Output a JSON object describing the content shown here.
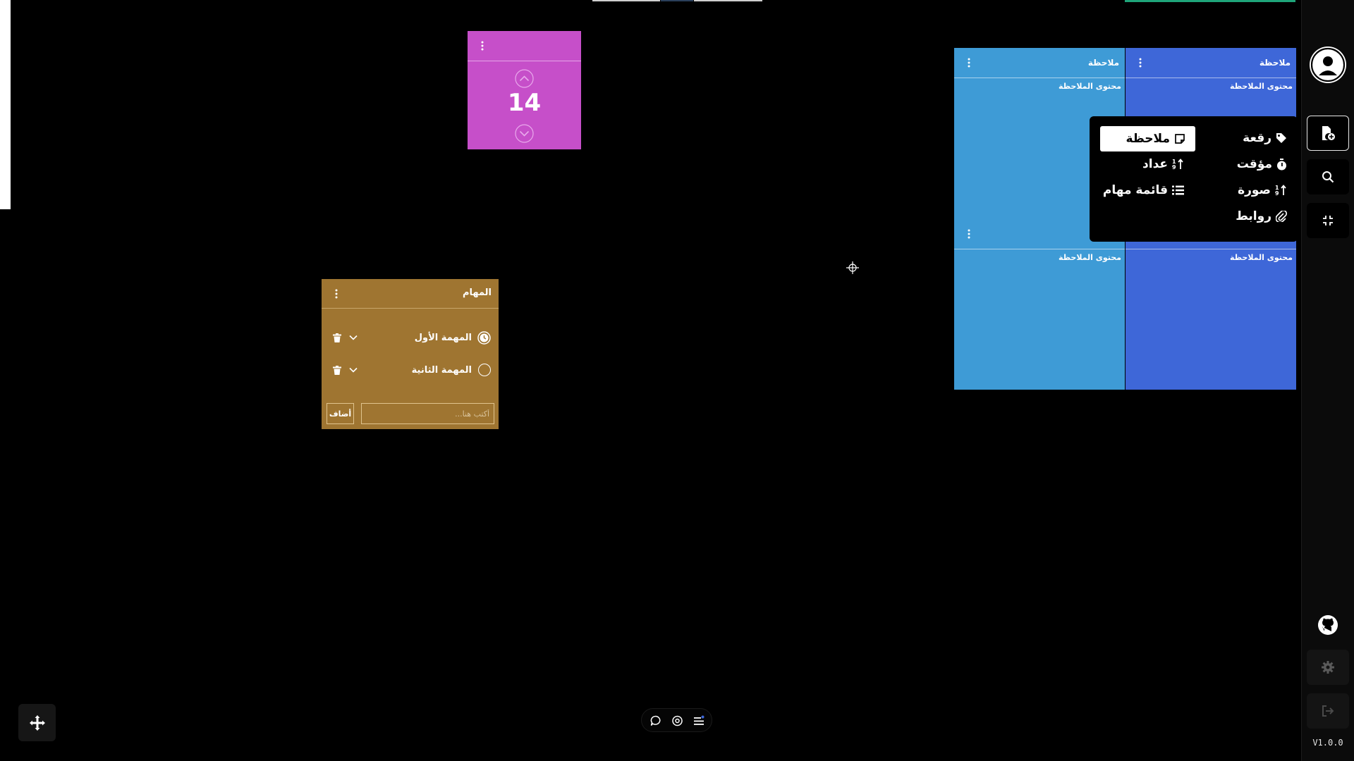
{
  "colors": {
    "counter_bg": "#c64fc9",
    "tasks_bg": "#9f7531",
    "note_light_blue": "#3e9bd6",
    "note_blue": "#3e67d8",
    "sidebar_bg": "#0b0b0b",
    "canvas_bg": "#000000"
  },
  "counter": {
    "value": "14",
    "icons": [
      "more-vertical-icon",
      "chevron-up-icon",
      "chevron-down-icon"
    ]
  },
  "tasks": {
    "title": "المهام",
    "items": [
      {
        "label": "المهمة الأول",
        "status": "in-progress"
      },
      {
        "label": "المهمة الثانية",
        "status": "todo"
      }
    ],
    "input_placeholder": "أكتب هنا...",
    "add_label": "أضاف"
  },
  "notes": [
    {
      "title": "ملاحظة",
      "content": "محتوى الملاحظة",
      "color": "light-blue"
    },
    {
      "title": "ملاحظة",
      "content": "محتوى الملاحظة",
      "color": "blue"
    },
    {
      "title": "",
      "content": "محتوى الملاحظة",
      "color": "light-blue"
    },
    {
      "title": "",
      "content": "محتوى الملاحظة",
      "color": "blue"
    }
  ],
  "add_menu": {
    "items": [
      {
        "label": "رقعة",
        "icon": "tag-icon"
      },
      {
        "label": "ملاحظة",
        "icon": "sticky-note-icon",
        "selected": true
      },
      {
        "label": "مؤقت",
        "icon": "stopwatch-icon"
      },
      {
        "label": "عداد",
        "icon": "sort-numeric-icon"
      },
      {
        "label": "صورة",
        "icon": "sort-numeric-icon"
      },
      {
        "label": "قائمة مهام",
        "icon": "list-icon"
      },
      {
        "label": "روابط",
        "icon": "paperclip-icon"
      }
    ]
  },
  "sidebar": {
    "buttons": [
      "user-avatar-icon",
      "add-file-icon",
      "search-icon",
      "compress-icon",
      "github-icon",
      "settings-icon",
      "logout-icon"
    ],
    "version": "V1.0.0"
  },
  "bottom_toolbar": {
    "buttons": [
      "comment-icon",
      "eye-icon",
      "list-settings-icon"
    ]
  },
  "canvas": {
    "crosshair_icon": "crosshair-icon",
    "move_button_icon": "move-arrows-icon"
  }
}
